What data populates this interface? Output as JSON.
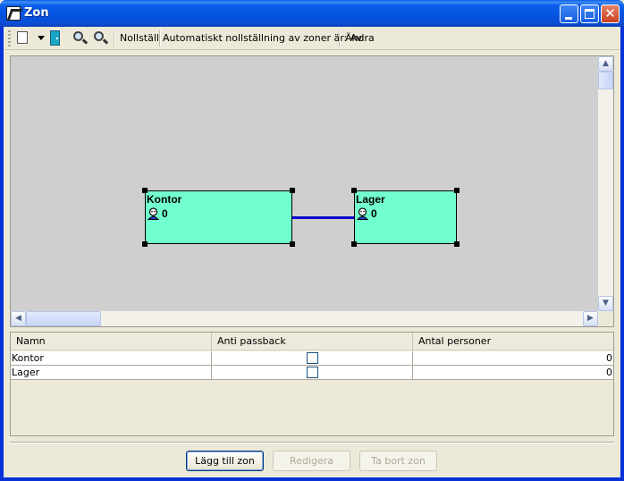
{
  "window": {
    "title": "Zon"
  },
  "toolbar": {
    "reset_label": "Nollställ",
    "auto_reset_label": "Automatiskt nollställning av zoner är: Av",
    "change_label": "Ändra"
  },
  "zones": [
    {
      "name": "Kontor",
      "count": "0"
    },
    {
      "name": "Lager",
      "count": "0"
    }
  ],
  "grid": {
    "columns": [
      "Namn",
      "Anti passback",
      "Antal personer"
    ],
    "rows": [
      {
        "name": "Kontor",
        "anti_passback": false,
        "count": "0"
      },
      {
        "name": "Lager",
        "anti_passback": false,
        "count": "0"
      }
    ]
  },
  "buttons": {
    "add": "Lägg till zon",
    "edit": "Redigera",
    "remove": "Ta bort zon"
  },
  "colors": {
    "zone_fill": "#72ffcf",
    "link": "#0000cc",
    "canvas": "#cfcfcf",
    "titlebar": "#0552e0"
  }
}
